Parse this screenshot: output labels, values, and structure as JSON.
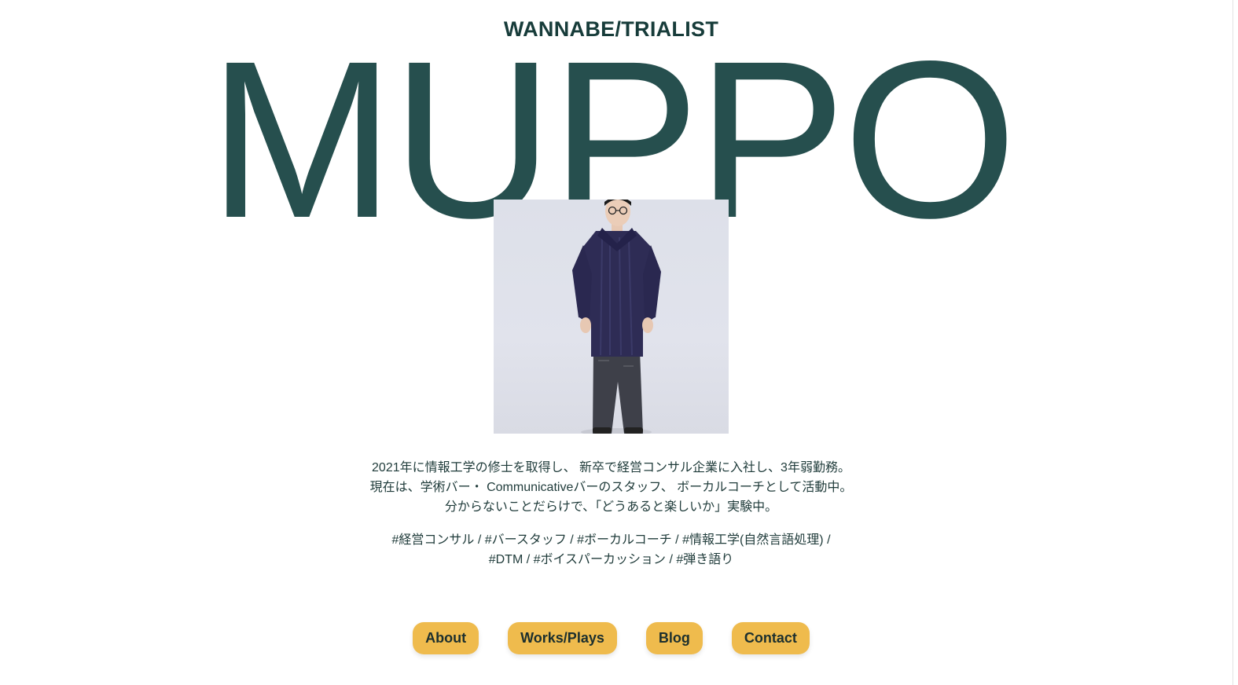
{
  "header": {
    "subtitle": "WANNABE/TRIALIST",
    "name": "MUPPO"
  },
  "bio": {
    "line1": "2021年に情報工学の修士を取得し、 新卒で経営コンサル企業に入社し、3年弱勤務。",
    "line2": "現在は、学術バー・ Communicativeバーのスタッフ、 ボーカルコーチとして活動中。",
    "line3": "分からないことだらけで、「どうあると楽しいか」実験中。"
  },
  "tags": {
    "line1": "#経営コンサル / #バースタッフ / #ボーカルコーチ / #情報工学(自然言語処理) /",
    "line2": "#DTM / #ボイスパーカッション / #弾き語り"
  },
  "nav": {
    "items": [
      {
        "label": "About"
      },
      {
        "label": "Works/Plays"
      },
      {
        "label": "Blog"
      },
      {
        "label": "Contact"
      }
    ]
  },
  "colors": {
    "title": "#264f4e",
    "subtitle": "#173c3a",
    "button": "#efbb4d",
    "text": "#1f3b3a"
  }
}
